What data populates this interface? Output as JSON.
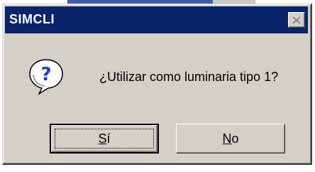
{
  "dialog": {
    "title": "SIMCLI",
    "close_icon": "close-icon",
    "icon": "question-icon",
    "message": "¿Utilizar como luminaria tipo 1?",
    "buttons": {
      "yes": {
        "label_mnemonic": "S",
        "label_rest": "í"
      },
      "no": {
        "label_mnemonic": "N",
        "label_rest": "o"
      }
    }
  },
  "colors": {
    "titlebar": "#0a246a",
    "dialog_face": "#d4d0c8",
    "title_text": "#ffffff",
    "icon_blue": "#1e3cc8"
  }
}
